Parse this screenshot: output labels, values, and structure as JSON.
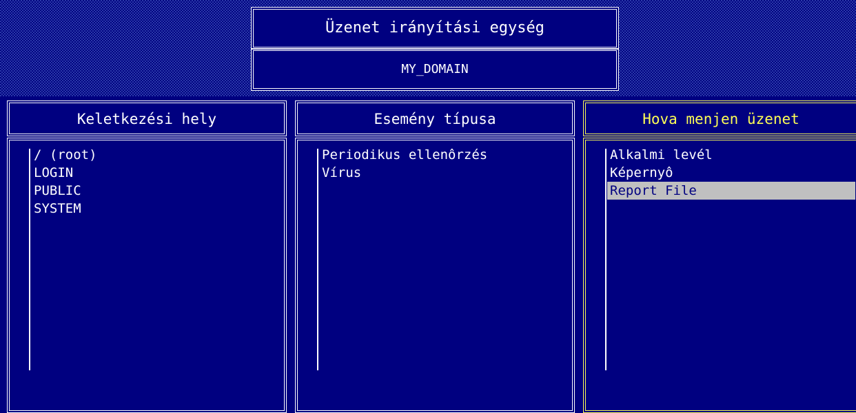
{
  "header": {
    "title": "Üzenet irányítási egység",
    "domain": "MY_DOMAIN"
  },
  "panels": [
    {
      "title": "Keletkezési hely",
      "items": [
        {
          "label": "/ (root)"
        },
        {
          "label": "LOGIN"
        },
        {
          "label": "PUBLIC"
        },
        {
          "label": "SYSTEM"
        }
      ]
    },
    {
      "title": "Esemény típusa",
      "items": [
        {
          "label": "Periodikus ellenôrzés"
        },
        {
          "label": "Vírus"
        }
      ]
    },
    {
      "title": "Hova menjen üzenet",
      "active": true,
      "items": [
        {
          "label": "Alkalmi levél"
        },
        {
          "label": "Képernyô"
        },
        {
          "label": "Report File",
          "selected": true
        }
      ]
    }
  ],
  "colors": {
    "background": "#000080",
    "border": "#ffffff",
    "active_border": "#ffff55",
    "selection": "#c0c0c0"
  }
}
